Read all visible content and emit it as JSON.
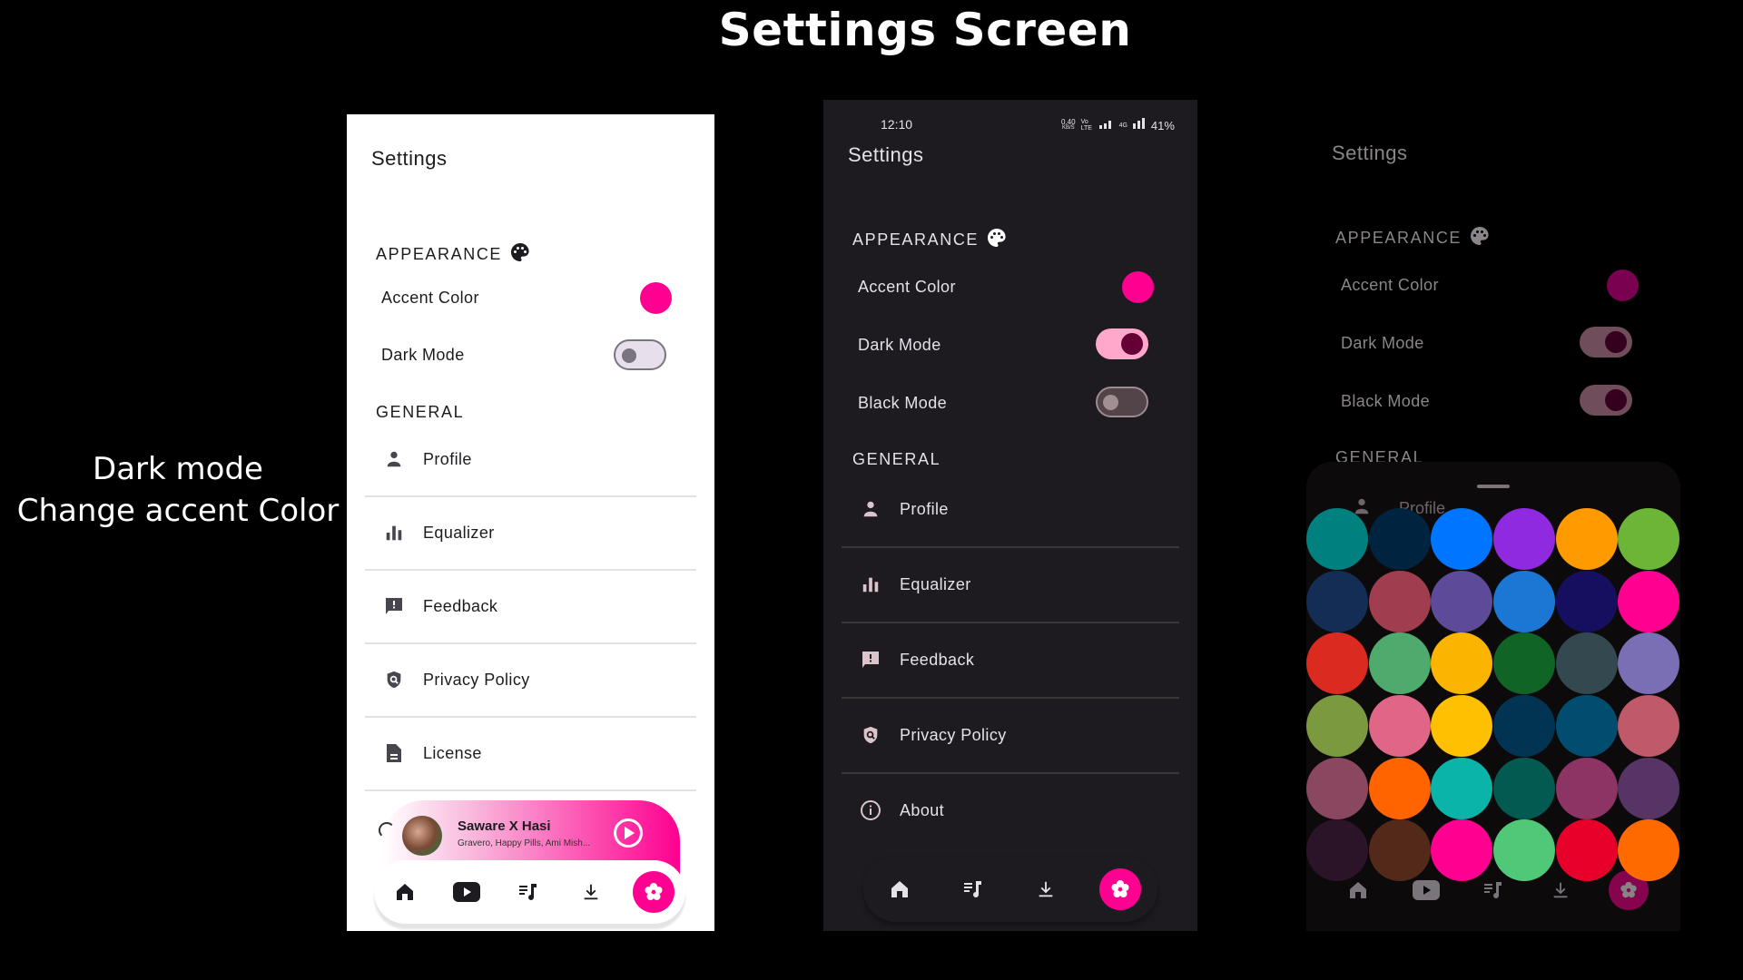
{
  "page_title": "Settings Screen",
  "caption": {
    "line1": "Dark mode",
    "line2": "Change accent Color"
  },
  "accent": "#ff0090",
  "light_screen": {
    "title": "Settings",
    "appearance_label": "APPEARANCE",
    "accent_color_label": "Accent Color",
    "accent_color_value": "#ff0090",
    "dark_mode_label": "Dark Mode",
    "dark_mode_on": false,
    "general_label": "GENERAL",
    "items": [
      {
        "label": "Profile",
        "icon": "person-icon"
      },
      {
        "label": "Equalizer",
        "icon": "equalizer-icon"
      },
      {
        "label": "Feedback",
        "icon": "feedback-icon"
      },
      {
        "label": "Privacy Policy",
        "icon": "privacy-shield-icon"
      },
      {
        "label": "License",
        "icon": "document-icon"
      }
    ],
    "mini_player": {
      "title": "Saware X Hasi",
      "artists": "Gravero, Happy Pills, Ami Mish...",
      "play_icon": "play-circle-icon"
    },
    "nav": [
      "home-icon",
      "youtube-icon",
      "playlist-icon",
      "download-icon",
      "settings-icon"
    ],
    "nav_active": "settings-icon"
  },
  "dark_screen": {
    "status_bar": {
      "time": "12:10",
      "speed": "0.40",
      "speed_unit": "KB/S",
      "network": "Vo LTE",
      "network2": "4G",
      "battery": "41%"
    },
    "title": "Settings",
    "appearance_label": "APPEARANCE",
    "accent_color_label": "Accent Color",
    "accent_color_value": "#ff0090",
    "dark_mode_label": "Dark Mode",
    "dark_mode_on": true,
    "black_mode_label": "Black Mode",
    "black_mode_on": false,
    "general_label": "GENERAL",
    "items": [
      {
        "label": "Profile",
        "icon": "person-icon"
      },
      {
        "label": "Equalizer",
        "icon": "equalizer-icon"
      },
      {
        "label": "Feedback",
        "icon": "feedback-icon"
      },
      {
        "label": "Privacy Policy",
        "icon": "privacy-shield-icon"
      },
      {
        "label": "About",
        "icon": "info-icon"
      }
    ],
    "nav": [
      "home-icon",
      "playlist-icon",
      "download-icon",
      "settings-icon"
    ],
    "nav_active": "settings-icon"
  },
  "picker_screen": {
    "title": "Settings",
    "appearance_label": "APPEARANCE",
    "accent_color_label": "Accent Color",
    "accent_color_value": "#7a0050",
    "dark_mode_label": "Dark Mode",
    "dark_mode_on": true,
    "black_mode_label": "Black Mode",
    "black_mode_on": true,
    "general_label": "GENERAL",
    "visible_item": "Profile",
    "colors": [
      "#00807f",
      "#002440",
      "#0075ff",
      "#8f2ae0",
      "#ff9a00",
      "#6db536",
      "#142d55",
      "#a03e50",
      "#5d4a98",
      "#1b77d3",
      "#160f60",
      "#ff0090",
      "#db2a20",
      "#4faa6e",
      "#fbb400",
      "#0f6426",
      "#344850",
      "#7a6eb4",
      "#7b9a40",
      "#e06688",
      "#fec000",
      "#003452",
      "#004d70",
      "#c05a6a",
      "#8a4860",
      "#ff6400",
      "#0ab4a8",
      "#035a50",
      "#8c3464",
      "#563465",
      "#2c1428",
      "#532a1a",
      "#ff0090",
      "#50c878",
      "#e6002a",
      "#ff6a00"
    ]
  }
}
